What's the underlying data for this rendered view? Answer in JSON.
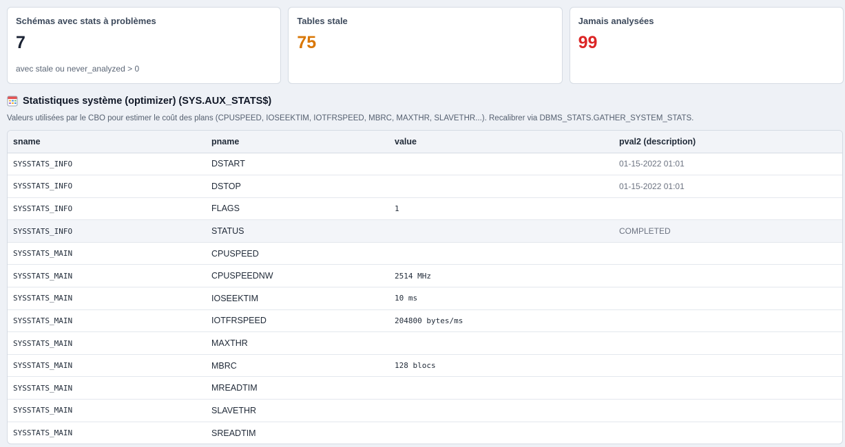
{
  "cards": [
    {
      "title": "Schémas avec stats à problèmes",
      "value": "7",
      "value_color": "#1a2233",
      "subtitle": "avec stale ou never_analyzed > 0"
    },
    {
      "title": "Tables stale",
      "value": "75",
      "value_color": "#d97706",
      "subtitle": ""
    },
    {
      "title": "Jamais analysées",
      "value": "99",
      "value_color": "#dc2626",
      "subtitle": ""
    }
  ],
  "section": {
    "icon": "table-icon",
    "title": "Statistiques système (optimizer) (SYS.AUX_STATS$)",
    "description": "Valeurs utilisées par le CBO pour estimer le coût des plans (CPUSPEED, IOSEEKTIM, IOTFRSPEED, MBRC, MAXTHR, SLAVETHR...). Recalibrer via DBMS_STATS.GATHER_SYSTEM_STATS."
  },
  "table": {
    "columns": [
      "sname",
      "pname",
      "value",
      "pval2 (description)"
    ],
    "rows": [
      {
        "sname": "SYSSTATS_INFO",
        "pname": "DSTART",
        "value": "",
        "pval2": "01-15-2022 01:01"
      },
      {
        "sname": "SYSSTATS_INFO",
        "pname": "DSTOP",
        "value": "",
        "pval2": "01-15-2022 01:01"
      },
      {
        "sname": "SYSSTATS_INFO",
        "pname": "FLAGS",
        "value": "1",
        "pval2": ""
      },
      {
        "sname": "SYSSTATS_INFO",
        "pname": "STATUS",
        "value": "",
        "pval2": "COMPLETED"
      },
      {
        "sname": "SYSSTATS_MAIN",
        "pname": "CPUSPEED",
        "value": "",
        "pval2": ""
      },
      {
        "sname": "SYSSTATS_MAIN",
        "pname": "CPUSPEEDNW",
        "value": "2514 MHz",
        "pval2": ""
      },
      {
        "sname": "SYSSTATS_MAIN",
        "pname": "IOSEEKTIM",
        "value": "10 ms",
        "pval2": ""
      },
      {
        "sname": "SYSSTATS_MAIN",
        "pname": "IOTFRSPEED",
        "value": "204800 bytes/ms",
        "pval2": ""
      },
      {
        "sname": "SYSSTATS_MAIN",
        "pname": "MAXTHR",
        "value": "",
        "pval2": ""
      },
      {
        "sname": "SYSSTATS_MAIN",
        "pname": "MBRC",
        "value": "128 blocs",
        "pval2": ""
      },
      {
        "sname": "SYSSTATS_MAIN",
        "pname": "MREADTIM",
        "value": "",
        "pval2": ""
      },
      {
        "sname": "SYSSTATS_MAIN",
        "pname": "SLAVETHR",
        "value": "",
        "pval2": ""
      },
      {
        "sname": "SYSSTATS_MAIN",
        "pname": "SREADTIM",
        "value": "",
        "pval2": ""
      }
    ]
  }
}
